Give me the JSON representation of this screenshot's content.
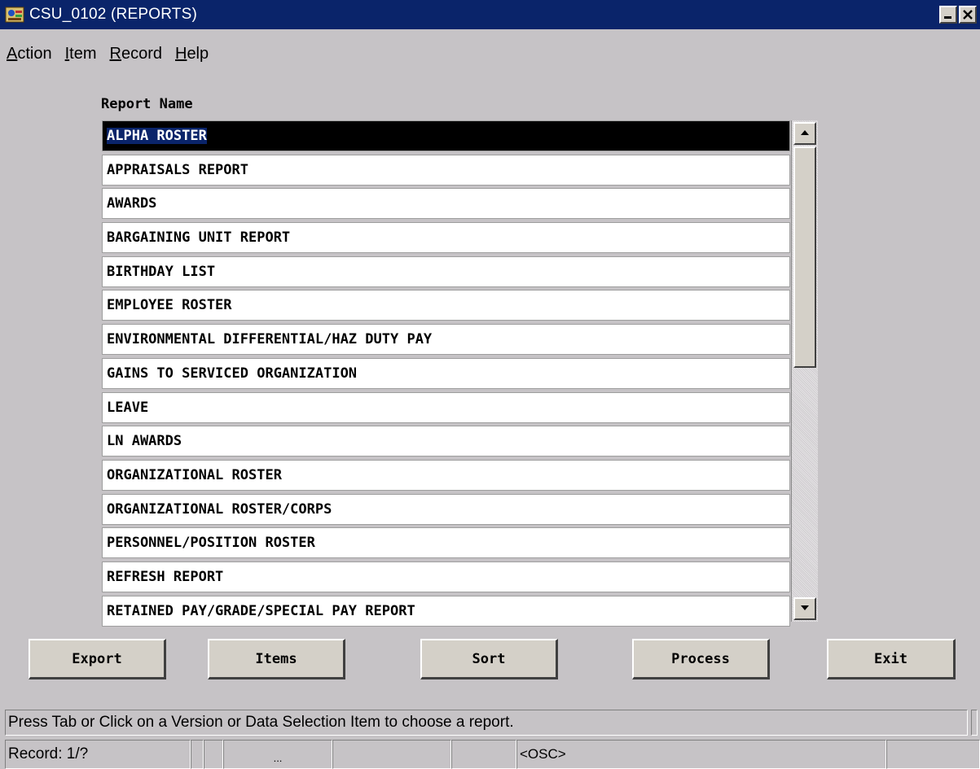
{
  "window": {
    "title": "CSU_0102 (REPORTS)"
  },
  "menu": [
    {
      "label": "Action",
      "mnemonic": "A",
      "rest": "ction"
    },
    {
      "label": "Item",
      "mnemonic": "I",
      "rest": "tem"
    },
    {
      "label": "Record",
      "mnemonic": "R",
      "rest": "ecord"
    },
    {
      "label": "Help",
      "mnemonic": "H",
      "rest": "elp"
    }
  ],
  "list": {
    "header": "Report Name",
    "selected_index": 0,
    "items": [
      "ALPHA ROSTER",
      "APPRAISALS REPORT",
      "AWARDS",
      "BARGAINING UNIT REPORT",
      "BIRTHDAY LIST",
      "EMPLOYEE ROSTER",
      "ENVIRONMENTAL DIFFERENTIAL/HAZ DUTY PAY",
      "GAINS TO SERVICED ORGANIZATION",
      "LEAVE",
      "LN AWARDS",
      "ORGANIZATIONAL ROSTER",
      "ORGANIZATIONAL ROSTER/CORPS",
      "PERSONNEL/POSITION ROSTER",
      "REFRESH REPORT",
      "RETAINED PAY/GRADE/SPECIAL PAY REPORT"
    ]
  },
  "buttons": {
    "export": "Export",
    "items": "Items",
    "sort": "Sort",
    "process": "Process",
    "exit": "Exit"
  },
  "hint": "Press Tab or Click on a Version or Data Selection Item to choose a report.",
  "status": {
    "record": "Record: 1/?",
    "ellipsis": "...",
    "mode": "<OSC>"
  },
  "colors": {
    "titlebar": "#0a246a",
    "background": "#c6c3c6",
    "selection": "#000000"
  }
}
